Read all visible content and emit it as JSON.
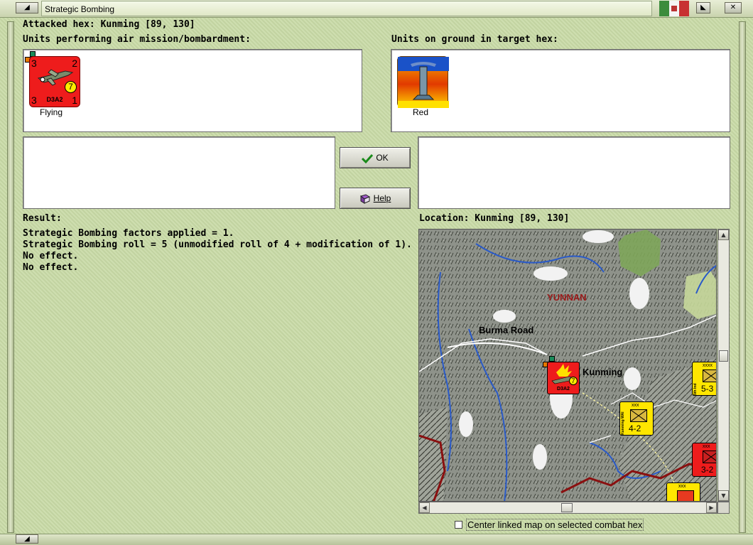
{
  "window": {
    "title": "Strategic Bombing"
  },
  "header": {
    "attacked_hex": "Attacked hex: Kunming  [89, 130]",
    "air_units_label": "Units performing air mission/bombardment:",
    "ground_units_label": "Units on ground in target hex:"
  },
  "air_units": [
    {
      "code": "D3A2",
      "top_left": "3",
      "top_right": "2",
      "bottom_left": "3",
      "bottom_right": "1",
      "circle": "7",
      "caption": "Flying"
    }
  ],
  "ground_units": [
    {
      "caption": "Red"
    }
  ],
  "buttons": {
    "ok_label": "OK",
    "help_label": "Help"
  },
  "result": {
    "label": "Result:",
    "lines": [
      "Strategic Bombing factors applied = 1.",
      "Strategic Bombing roll = 5 (unmodified roll of 4 + modification of 1).",
      "No effect.",
      "No effect."
    ]
  },
  "location": {
    "label": "Location:  Kunming  [89, 130]"
  },
  "map": {
    "region_label": "YUNNAN",
    "road_label": "Burma Road",
    "city_label": "Kunming",
    "counters": [
      {
        "top": "xxx",
        "side": "Kunming WAI",
        "value": "4-2",
        "color": "#ffe600"
      },
      {
        "top": "xxxx",
        "side": "5th Ind",
        "value": "5-3",
        "color": "#ffe600"
      },
      {
        "top": "xxx",
        "side": "",
        "value": "3-2",
        "color": "#ee1c1c"
      },
      {
        "top": "xxx",
        "side": "",
        "value": "",
        "color": "#ffe600"
      }
    ],
    "plane_counter": {
      "code": "D3A2",
      "circle": "7"
    }
  },
  "footer": {
    "center_checkbox_label": "Center linked map on selected combat hex",
    "center_checkbox_checked": false
  },
  "colors": {
    "background": "#c8daa6",
    "axis_red": "#ee1c1c",
    "allied_yellow": "#ffe600"
  }
}
